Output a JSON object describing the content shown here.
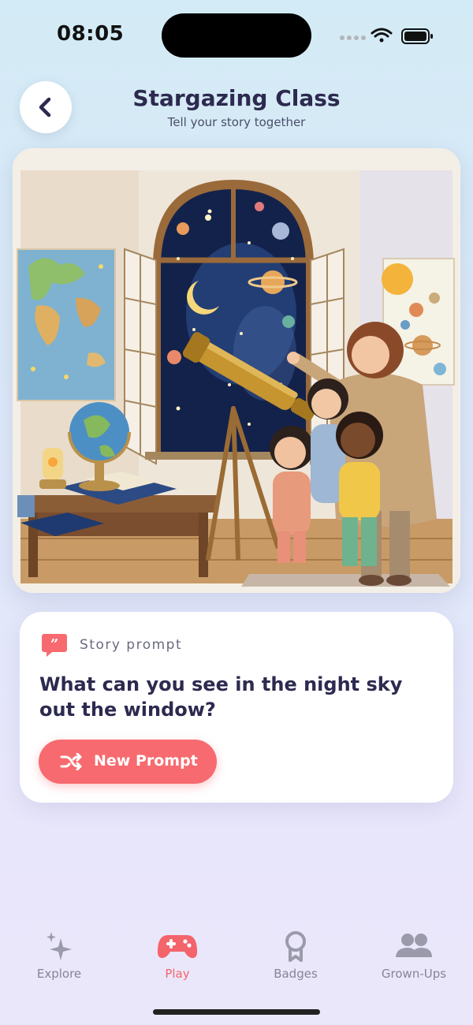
{
  "status_bar": {
    "time": "08:05"
  },
  "header": {
    "title": "Stargazing Class",
    "subtitle": "Tell your story together"
  },
  "scene": {
    "illustration": "classroom-stargazing-illustration"
  },
  "prompt_card": {
    "label": "Story prompt",
    "question": "What can you see in the night sky out the window?",
    "button_label": "New Prompt"
  },
  "tab_bar": {
    "tabs": [
      {
        "label": "Explore",
        "icon": "sparkles-icon",
        "active": false
      },
      {
        "label": "Play",
        "icon": "gamepad-icon",
        "active": true
      },
      {
        "label": "Badges",
        "icon": "badge-icon",
        "active": false
      },
      {
        "label": "Grown-Ups",
        "icon": "people-icon",
        "active": false
      }
    ]
  },
  "colors": {
    "accent": "#f76a6f",
    "title": "#2c2a4f",
    "inactive_tab": "#858596"
  }
}
